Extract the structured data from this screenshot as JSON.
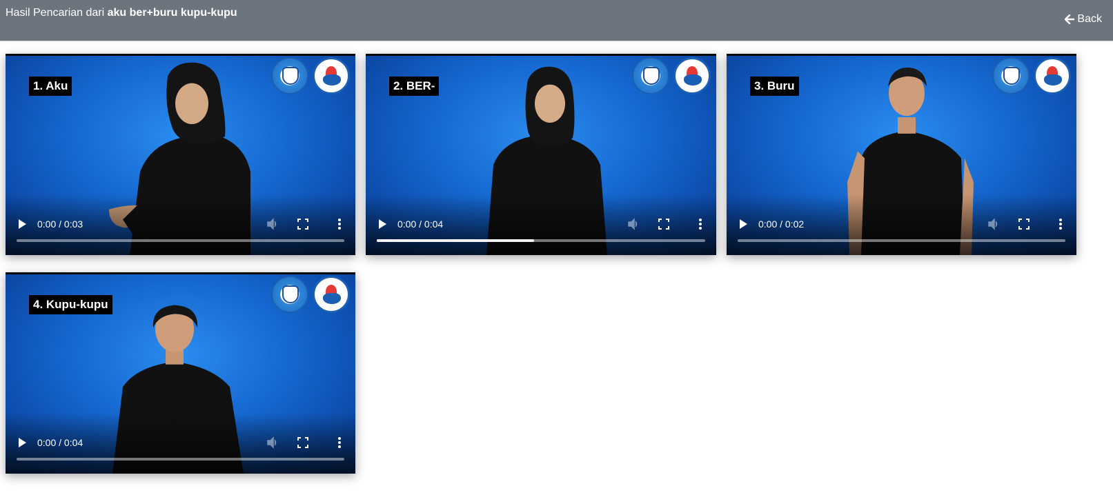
{
  "header": {
    "title_prefix": "Hasil Pencarian dari ",
    "query": "aku ber+buru kupu-kupu",
    "back_label": "Back"
  },
  "videos": [
    {
      "caption": "1. Aku",
      "time": "0:00 / 0:03",
      "buffered": 0
    },
    {
      "caption": "2. BER-",
      "time": "0:00 / 0:04",
      "buffered": 0.48
    },
    {
      "caption": "3. Buru",
      "time": "0:00 / 0:02",
      "buffered": 0
    },
    {
      "caption": "4. Kupu-kupu",
      "time": "0:00 / 0:04",
      "buffered": 0
    }
  ],
  "colors": {
    "topbar": "#6c757d",
    "video_background": "#1567cf",
    "clothing": "#111111"
  }
}
